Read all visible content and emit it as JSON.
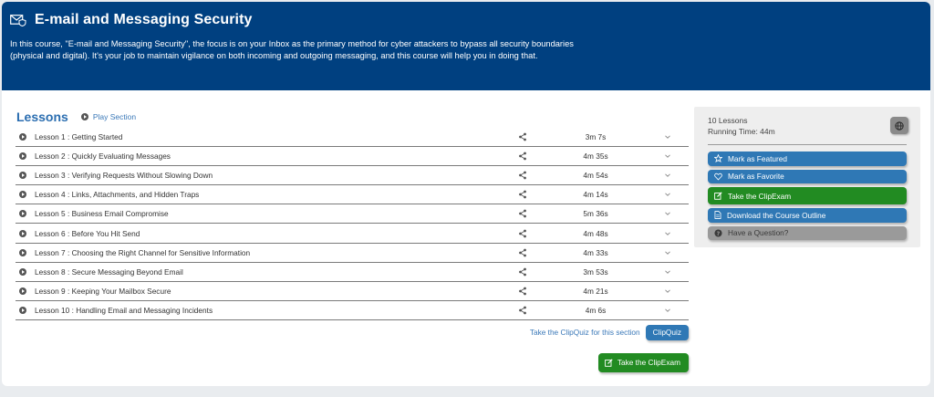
{
  "header": {
    "title": "E-mail and Messaging Security",
    "description": "In this course, \"E-mail and Messaging Security\", the focus is on your Inbox as the primary method for cyber attackers to bypass all security boundaries (physical and digital). It's your job to maintain vigilance on both incoming and outgoing messaging, and this course will help you in doing that.",
    "icon": "envelope-shield-icon"
  },
  "lessons": {
    "title": "Lessons",
    "play_section_label": "Play Section",
    "items": [
      {
        "label": "Lesson 1 : Getting Started",
        "duration": "3m 7s"
      },
      {
        "label": "Lesson 2 : Quickly Evaluating Messages",
        "duration": "4m 35s"
      },
      {
        "label": "Lesson 3 : Verifying Requests Without Slowing Down",
        "duration": "4m 54s"
      },
      {
        "label": "Lesson 4 : Links, Attachments, and Hidden Traps",
        "duration": "4m 14s"
      },
      {
        "label": "Lesson 5 : Business Email Compromise",
        "duration": "5m 36s"
      },
      {
        "label": "Lesson 6 : Before You Hit Send",
        "duration": "4m 48s"
      },
      {
        "label": "Lesson 7 : Choosing the Right Channel for Sensitive Information",
        "duration": "4m 33s"
      },
      {
        "label": "Lesson 8 : Secure Messaging Beyond Email",
        "duration": "3m 53s"
      },
      {
        "label": "Lesson 9 : Keeping Your Mailbox Secure",
        "duration": "4m 21s"
      },
      {
        "label": "Lesson 10 : Handling Email and Messaging Incidents",
        "duration": "4m 6s"
      }
    ],
    "quiz_prompt": "Take the ClipQuiz for this section",
    "clipquiz_button": "ClipQuiz",
    "clipexam_button": "Take the ClipExam"
  },
  "sidebar": {
    "lessons_count": "10 Lessons",
    "running_time": "Running Time: 44m",
    "actions": {
      "featured": "Mark as Featured",
      "favorite": "Mark as Favorite",
      "clipexam": "Take the ClipExam",
      "outline": "Download the Course Outline",
      "question": "Have a Question?"
    }
  },
  "colors": {
    "header_bg": "#004080",
    "accent_blue": "#2f78b5",
    "accent_green": "#228b22",
    "muted_grey": "#9a9a9a"
  }
}
